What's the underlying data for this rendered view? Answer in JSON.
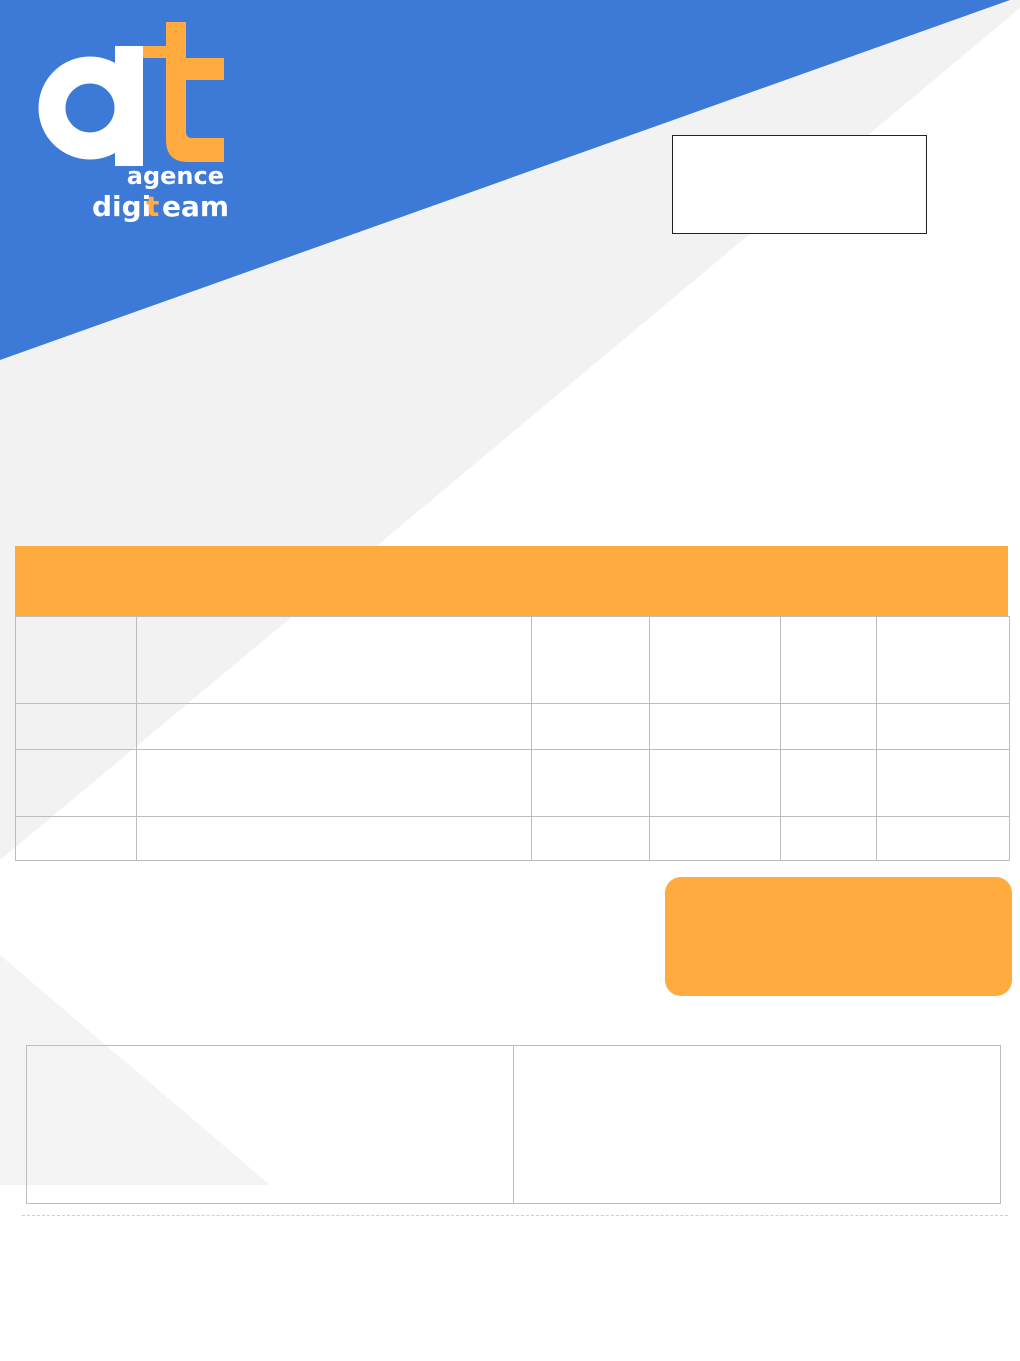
{
  "colors": {
    "brand_blue": "#3d7ad8",
    "brand_orange": "#ffab40",
    "light_gray": "#f2f2f2",
    "white": "#ffffff"
  },
  "logo": {
    "brand_primary": "agence",
    "brand_secondary": "digiteam",
    "monogram": "dt"
  },
  "invoice_table": {
    "rows": [
      [
        "",
        "",
        "",
        "",
        "",
        ""
      ],
      [
        "",
        "",
        "",
        "",
        "",
        ""
      ],
      [
        "",
        "",
        "",
        "",
        "",
        ""
      ],
      [
        "",
        "",
        "",
        "",
        "",
        ""
      ]
    ]
  }
}
